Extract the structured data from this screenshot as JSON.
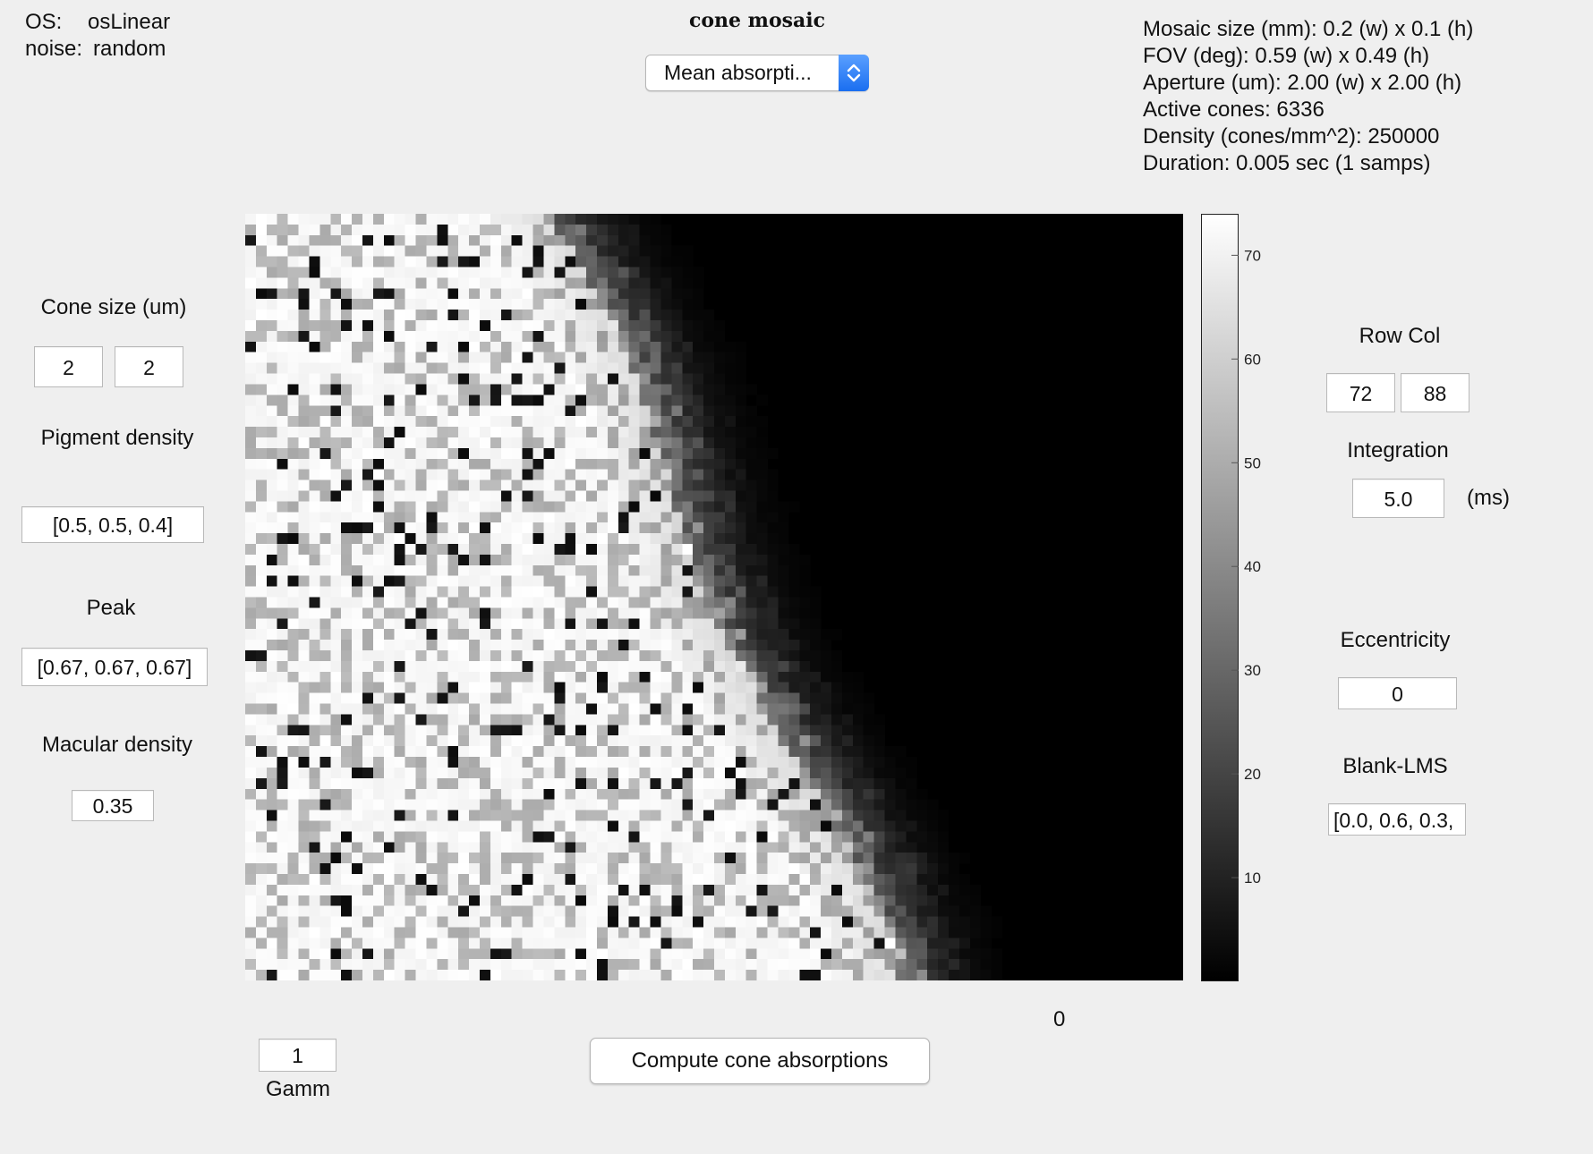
{
  "window_title": "cone mosaic",
  "os_info": {
    "os_label": "OS:",
    "os_value": "osLinear",
    "noise_label": "noise:",
    "noise_value": "random"
  },
  "display_menu": {
    "selected": "Mean absorpti..."
  },
  "mosaic_info": [
    "Mosaic size (mm): 0.2 (w) x 0.1 (h)",
    "FOV (deg): 0.59 (w) x 0.49 (h)",
    "Aperture (um): 2.00 (w) x 2.00 (h)",
    "Active cones: 6336",
    "Density (cones/mm^2): 250000",
    "Duration:  0.005 sec (1 samps)"
  ],
  "left_panel": {
    "cone_size_label": "Cone size (um)",
    "cone_size_w": "2",
    "cone_size_h": "2",
    "pigment_density_label": "Pigment density",
    "pigment_density": "[0.5, 0.5, 0.4]",
    "peak_label": "Peak",
    "peak": "[0.67, 0.67, 0.67]",
    "macular_density_label": "Macular density",
    "macular_density": "0.35"
  },
  "right_panel": {
    "row_col_label": "Row Col",
    "rows": "72",
    "cols": "88",
    "integration_label": "Integration",
    "integration": "5.0",
    "integration_unit": "(ms)",
    "eccentricity_label": "Eccentricity",
    "eccentricity": "0",
    "blank_lms_label": "Blank-LMS",
    "blank_lms": "[0.0, 0.6, 0.3,"
  },
  "bottom": {
    "gamma_value": "1",
    "gamma_label": "Gamm",
    "compute_button": "Compute cone absorptions",
    "time_readout": "0"
  },
  "colorbar": {
    "min": 0,
    "max": 74,
    "ticks": [
      "10",
      "20",
      "30",
      "40",
      "50",
      "60",
      "70"
    ]
  },
  "mosaic_image": {
    "rows": 72,
    "cols": 88,
    "colormap": "gray",
    "content": "cone absorptions, bright on left falling to dark on right"
  }
}
